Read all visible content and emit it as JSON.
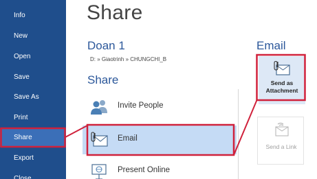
{
  "sidebar": {
    "items": [
      {
        "label": "Info"
      },
      {
        "label": "New"
      },
      {
        "label": "Open"
      },
      {
        "label": "Save"
      },
      {
        "label": "Save As"
      },
      {
        "label": "Print"
      },
      {
        "label": "Share"
      },
      {
        "label": "Export"
      },
      {
        "label": "Close"
      }
    ],
    "active_item": "Share"
  },
  "page": {
    "title": "Share",
    "document_name": "Doan 1",
    "document_path": "D: » Giaotrinh » CHUNGCHI_B"
  },
  "share_section": {
    "heading": "Share",
    "options": [
      {
        "label": "Invite People",
        "icon": "people-icon"
      },
      {
        "label": "Email",
        "icon": "email-attachment-icon"
      },
      {
        "label": "Present Online",
        "icon": "present-online-icon"
      }
    ],
    "selected": "Email"
  },
  "email_section": {
    "heading": "Email",
    "commands": [
      {
        "label": "Send as\nAttachment",
        "icon": "attachment-icon",
        "enabled": true
      },
      {
        "label": "Send a Link",
        "icon": "link-icon",
        "enabled": false
      }
    ]
  },
  "colors": {
    "sidebar_bg": "#1f4e8c",
    "sidebar_active": "#3b6fb8",
    "accent_blue": "#2b579a",
    "selection_bg": "#c5dbf5",
    "annotation_red": "#d0213b"
  }
}
